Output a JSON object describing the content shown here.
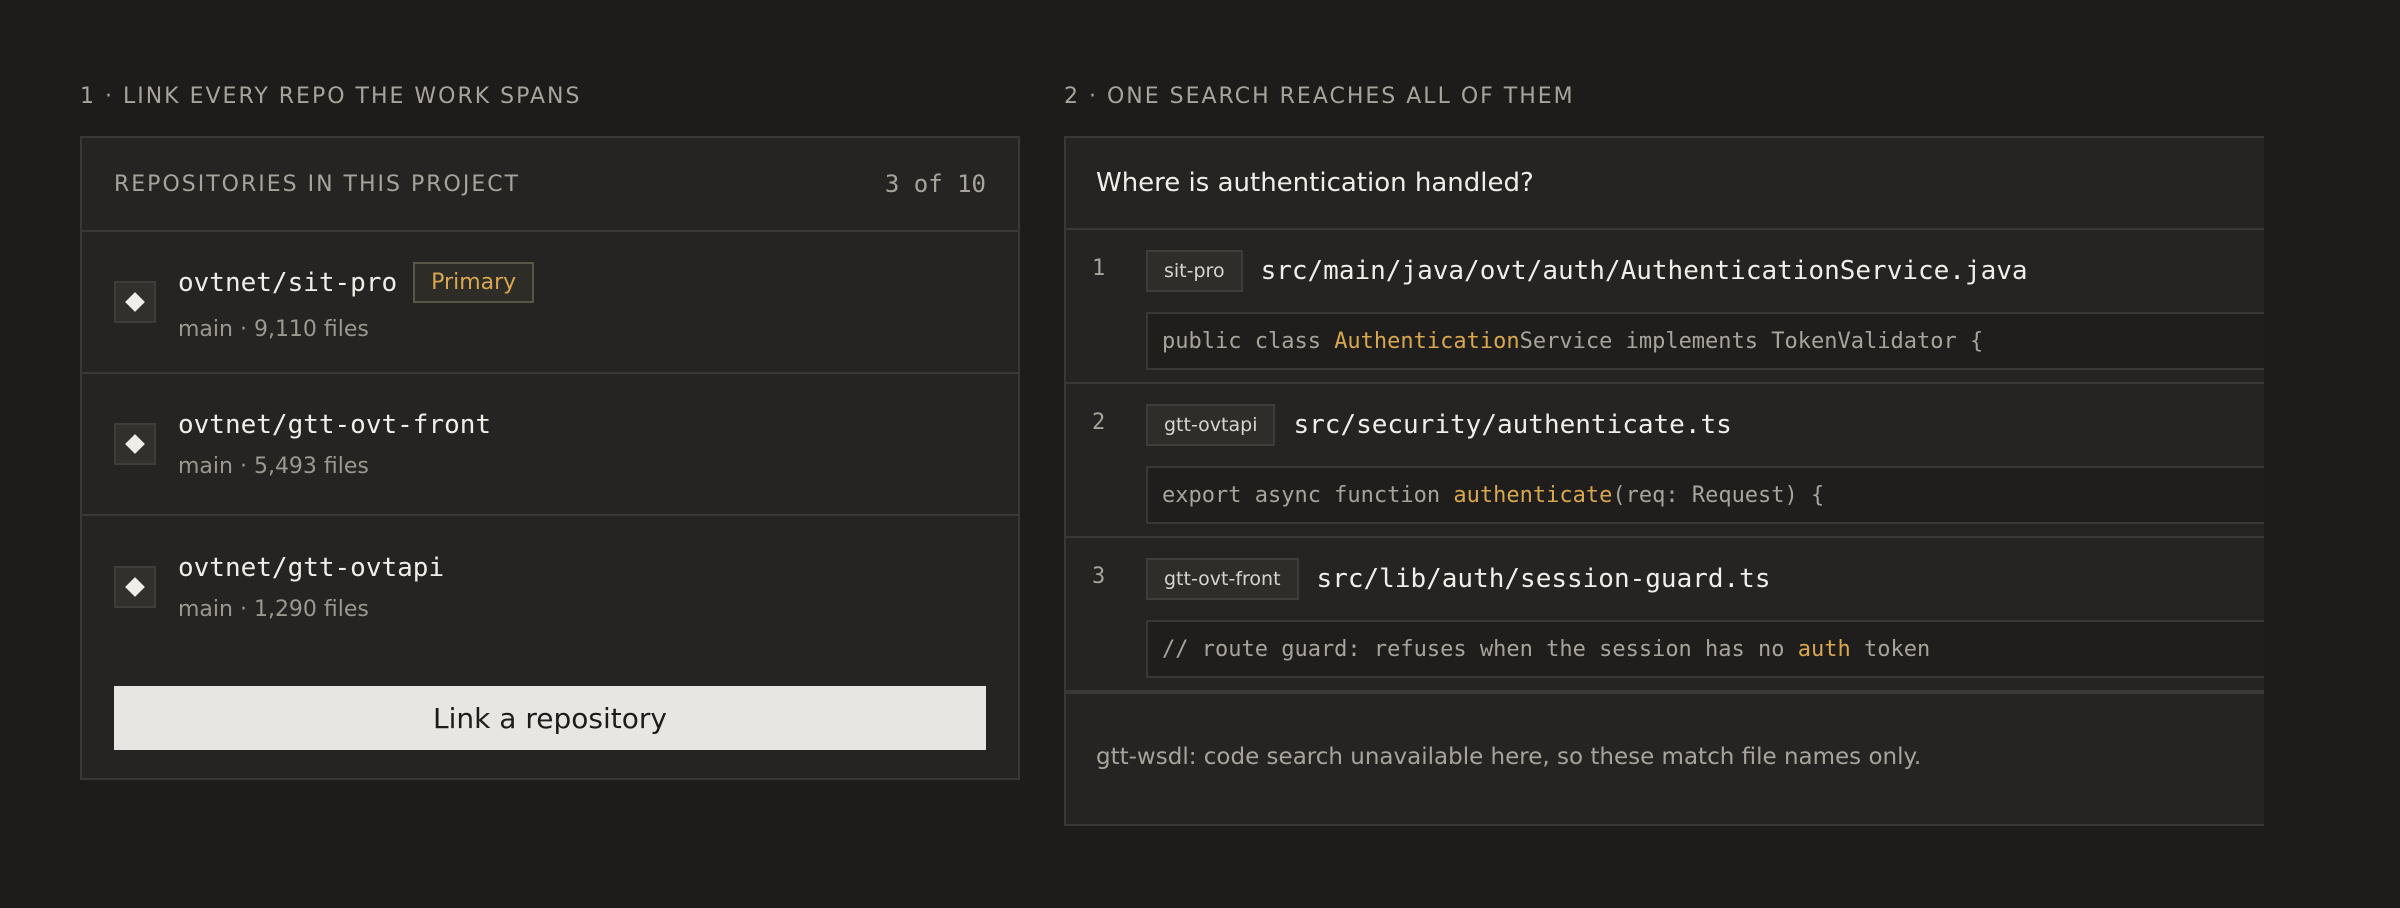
{
  "steps": {
    "step1": "1 · LINK EVERY REPO THE WORK SPANS",
    "step2": "2 · ONE SEARCH REACHES ALL OF THEM"
  },
  "repos_panel": {
    "title": "REPOSITORIES IN THIS PROJECT",
    "count": "3 of 10",
    "items": [
      {
        "name": "ovtnet/sit-pro",
        "badge": "Primary",
        "meta": "main · 9,110 files",
        "icon": "diamond-icon"
      },
      {
        "name": "ovtnet/gtt-ovt-front",
        "badge": "",
        "meta": "main · 5,493 files",
        "icon": "diamond-icon"
      },
      {
        "name": "ovtnet/gtt-ovtapi",
        "badge": "",
        "meta": "main · 1,290 files",
        "icon": "diamond-icon"
      }
    ],
    "link_button": "Link a repository"
  },
  "search_panel": {
    "query": "Where is authentication handled?",
    "results": [
      {
        "num": "1",
        "repo": "sit-pro",
        "path": "src/main/java/ovt/auth/AuthenticationService.java",
        "snippet_before": "public class ",
        "snippet_match": "Authentication",
        "snippet_after": "Service implements TokenValidator {"
      },
      {
        "num": "2",
        "repo": "gtt-ovtapi",
        "path": "src/security/authenticate.ts",
        "snippet_before": "export async function ",
        "snippet_match": "authenticate",
        "snippet_after": "(req: Request) {"
      },
      {
        "num": "3",
        "repo": "gtt-ovt-front",
        "path": "src/lib/auth/session-guard.ts",
        "snippet_before": "// route guard: refuses when the session has no ",
        "snippet_match": "auth",
        "snippet_after": " token"
      }
    ],
    "note": "gtt-wsdl: code search unavailable here, so these match file names only."
  },
  "colors": {
    "background": "#1d1c1a",
    "panel": "#252422",
    "accent": "#d9a74e",
    "button": "#e8e6e2"
  }
}
